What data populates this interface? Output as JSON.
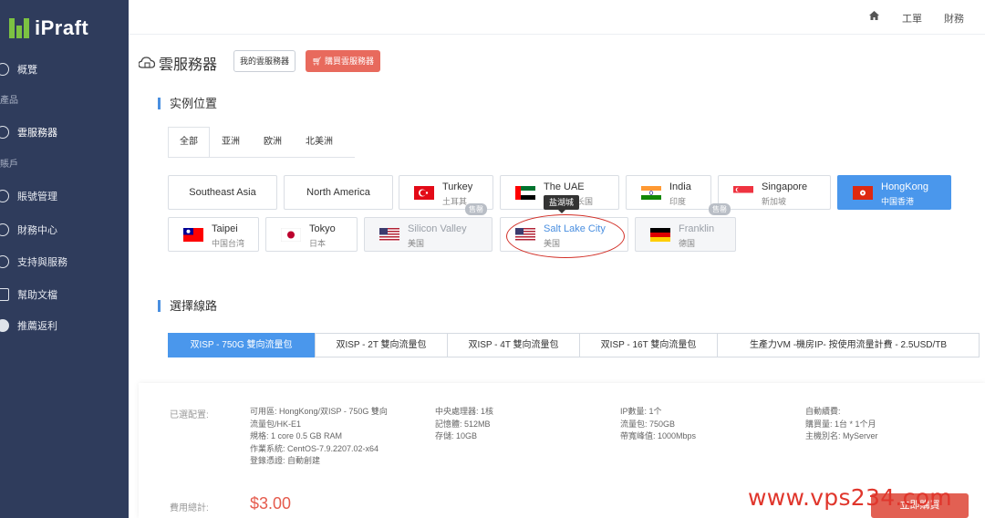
{
  "app": {
    "logo_text": "iPraft"
  },
  "sidebar": {
    "items": [
      {
        "label": "概覽"
      },
      {
        "label": "產品"
      },
      {
        "label": "雲服務器"
      },
      {
        "label": "賬戶"
      },
      {
        "label": "賬號管理"
      },
      {
        "label": "財務中心"
      },
      {
        "label": "支持與服務"
      },
      {
        "label": "幫助文檔"
      },
      {
        "label": "推薦返利"
      }
    ]
  },
  "topbar": {
    "ticket": "工單",
    "finance": "財務"
  },
  "page": {
    "title": "雲服務器",
    "my_servers_button": "我的雲服務器",
    "buy_button": "購買雲服務器"
  },
  "location_section": {
    "title": "实例位置",
    "tabs": [
      "全部",
      "亚洲",
      "欧洲",
      "北美洲"
    ],
    "regions": [
      "Southeast Asia",
      "North America"
    ],
    "cities": [
      {
        "name": "Turkey",
        "sub": "土耳其"
      },
      {
        "name": "The UAE",
        "sub": "阿联酋西长国"
      },
      {
        "name": "India",
        "sub": "印度"
      },
      {
        "name": "Singapore",
        "sub": "新加坡"
      },
      {
        "name": "HongKong",
        "sub": "中国香港"
      },
      {
        "name": "Taipei",
        "sub": "中国台湾"
      },
      {
        "name": "Tokyo",
        "sub": "日本"
      },
      {
        "name": "Silicon Valley",
        "sub": "美国"
      },
      {
        "name": "Salt Lake City",
        "sub": "美国"
      },
      {
        "name": "Franklin",
        "sub": "德国"
      }
    ],
    "soldout_badge": "售罄",
    "tooltip": "盐湖城"
  },
  "line_section": {
    "title": "選擇線路",
    "options": [
      "双ISP - 750G 雙向流量包",
      "双ISP - 2T 雙向流量包",
      "双ISP - 4T 雙向流量包",
      "双ISP - 16T 雙向流量包",
      "生產力VM -機房IP- 按使用流量計費 - 2.5USD/TB"
    ]
  },
  "config": {
    "label": "已選配置:",
    "col1": [
      "可用區: HongKong/双ISP - 750G 雙向",
      "流量包/HK-E1",
      "規格: 1 core 0.5 GB RAM",
      "作業系統: CentOS-7.9.2207.02-x64",
      "登錄憑證: 自動創建"
    ],
    "col2": [
      "中央處理器: 1核",
      "記憶體: 512MB",
      "存儲: 10GB"
    ],
    "col3": [
      "IP數量: 1个",
      "流量包: 750GB",
      "帶寬峰值: 1000Mbps"
    ],
    "col4": [
      "自動續費:",
      "購買量: 1台 * 1个月",
      "主機別名: MyServer"
    ],
    "fee_label": "費用總計:",
    "fee": "$3.00",
    "buy_now": "立即購買"
  },
  "watermark": "www.vps234.com",
  "colors": {
    "sidebar": "#2f3c5c",
    "accent": "#4a97ec",
    "danger": "#e86a5d",
    "logo_green": "#7cc242"
  }
}
